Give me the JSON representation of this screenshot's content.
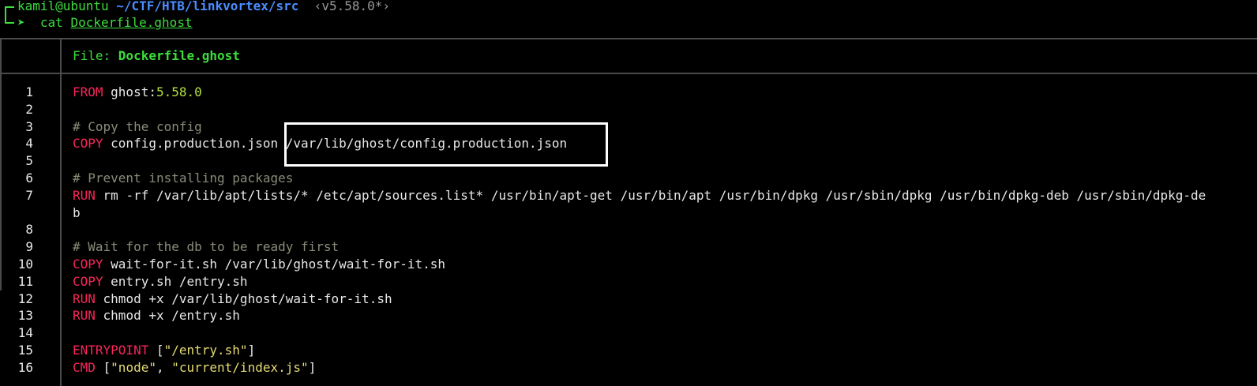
{
  "prompt": {
    "user_host": "kamil@ubuntu",
    "path": "~/CTF/HTB/linkvortex/src",
    "git": "‹v5.58.0*›",
    "arrow": "➤",
    "command": "cat",
    "argument": "Dockerfile.ghost"
  },
  "file_header": {
    "label": "File: ",
    "name": "Dockerfile.ghost"
  },
  "lines": [
    {
      "n": "1",
      "kw": "FROM",
      "text": " ghost:",
      "extra": "5.58.0"
    },
    {
      "n": "2",
      "kw": "",
      "text": ""
    },
    {
      "n": "3",
      "comment": "# Copy the config"
    },
    {
      "n": "4",
      "kw": "COPY",
      "text": " config.production.json /var/lib/ghost/config.production.json"
    },
    {
      "n": "5",
      "kw": "",
      "text": ""
    },
    {
      "n": "6",
      "comment": "# Prevent installing packages"
    },
    {
      "n": "7",
      "kw": "RUN",
      "text": " rm -rf /var/lib/apt/lists/* /etc/apt/sources.list* /usr/bin/apt-get /usr/bin/apt /usr/bin/dpkg /usr/sbin/dpkg /usr/bin/dpkg-deb /usr/sbin/dpkg-de"
    },
    {
      "n": "",
      "kw": "",
      "text": "b"
    },
    {
      "n": "8",
      "kw": "",
      "text": ""
    },
    {
      "n": "9",
      "comment": "# Wait for the db to be ready first"
    },
    {
      "n": "10",
      "kw": "COPY",
      "text": " wait-for-it.sh /var/lib/ghost/wait-for-it.sh"
    },
    {
      "n": "11",
      "kw": "COPY",
      "text": " entry.sh /entry.sh"
    },
    {
      "n": "12",
      "kw": "RUN",
      "text": " chmod +x /var/lib/ghost/wait-for-it.sh"
    },
    {
      "n": "13",
      "kw": "RUN",
      "text": " chmod +x /entry.sh"
    },
    {
      "n": "14",
      "kw": "",
      "text": ""
    },
    {
      "n": "15",
      "kw": "ENTRYPOINT",
      "text": " [",
      "str1": "\"/entry.sh\"",
      "tail": "]"
    },
    {
      "n": "16",
      "kw": "CMD",
      "text": " [",
      "str1": "\"node\"",
      "mid": ", ",
      "str2": "\"current/index.js\"",
      "tail": "]"
    }
  ],
  "colors": {
    "background": "#000000",
    "keyword": "#f9265a",
    "comment": "#8b8b7a",
    "number": "#b6e33b",
    "string": "#e6db74",
    "prompt_green": "#3ddc3d",
    "path_blue": "#4a8dff"
  }
}
